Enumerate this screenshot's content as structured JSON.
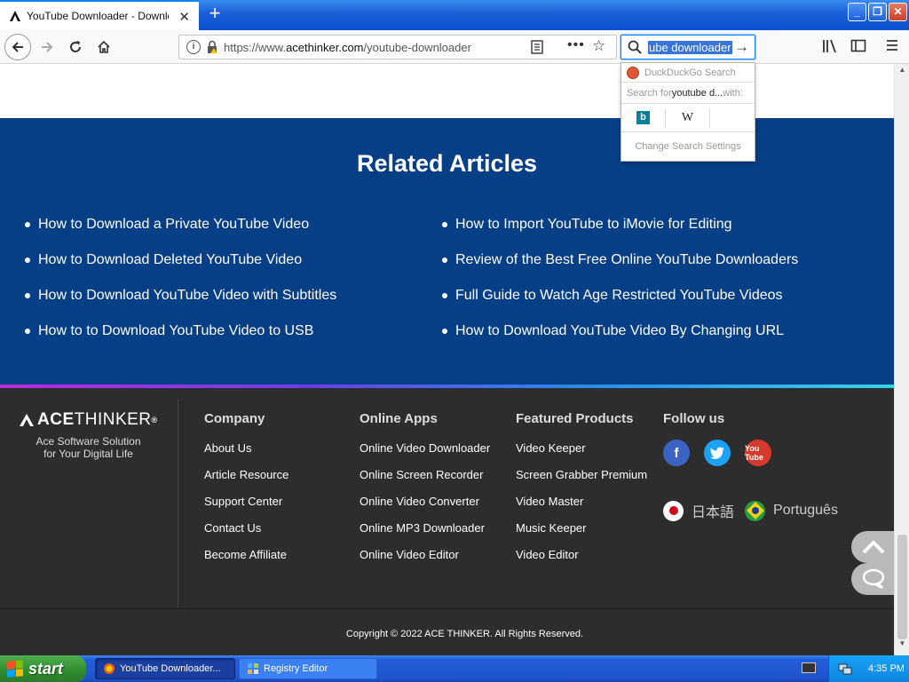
{
  "browser": {
    "tab_title": "YouTube Downloader - Download Y",
    "new_tab": "+",
    "url_prefix": "https://www.",
    "url_domain": "acethinker.com",
    "url_path": "/youtube-downloader",
    "search_value": "ube downloader",
    "dropdown": {
      "engine_name": "DuckDuckGo Search",
      "search_for_prefix": "Search for ",
      "search_for_query": "youtube d...",
      "search_for_suffix": " with:",
      "engine_bing": "b",
      "engine_wiki": "W",
      "settings": "Change Search Settings"
    }
  },
  "related": {
    "title": "Related Articles",
    "left": [
      "How to Download a Private YouTube Video",
      "How to Download Deleted YouTube Video",
      "How to Download YouTube Video with Subtitles",
      "How to to Download YouTube Video to USB"
    ],
    "right": [
      "How to Import YouTube to iMovie for Editing",
      "Review of the Best Free Online YouTube Downloaders",
      "Full Guide to Watch Age Restricted YouTube Videos",
      "How to Download YouTube Video By Changing URL"
    ]
  },
  "footer": {
    "logo_bold": "ACE",
    "logo_thin": "THINKER",
    "logo_reg": "®",
    "tagline_1": "Ace Software Solution",
    "tagline_2": "for Your Digital Life",
    "company": {
      "title": "Company",
      "links": [
        "About Us",
        "Article Resource",
        "Support Center",
        "Contact Us",
        "Become Affiliate"
      ]
    },
    "apps": {
      "title": "Online Apps",
      "links": [
        "Online Video Downloader",
        "Online Screen Recorder",
        "Online Video Converter",
        "Online MP3 Downloader",
        "Online Video Editor"
      ]
    },
    "products": {
      "title": "Featured Products",
      "links": [
        "Video Keeper",
        "Screen Grabber Premium",
        "Video Master",
        "Music Keeper",
        "Video Editor"
      ]
    },
    "follow": {
      "title": "Follow us",
      "fb": "f",
      "yt": "You Tube"
    },
    "lang_jp": "日本語",
    "lang_pt": "Português",
    "copyright": "Copyright © 2022 ACE THINKER. All Rights Reserved."
  },
  "taskbar": {
    "start": "start",
    "task_youtube": "YouTube Downloader...",
    "task_registry": "Registry Editor",
    "time": "4:35 PM"
  },
  "colors": {
    "related_bg": "#063f86",
    "footer_bg": "#2d2d2d",
    "xp_start": "#2e8b2e"
  }
}
